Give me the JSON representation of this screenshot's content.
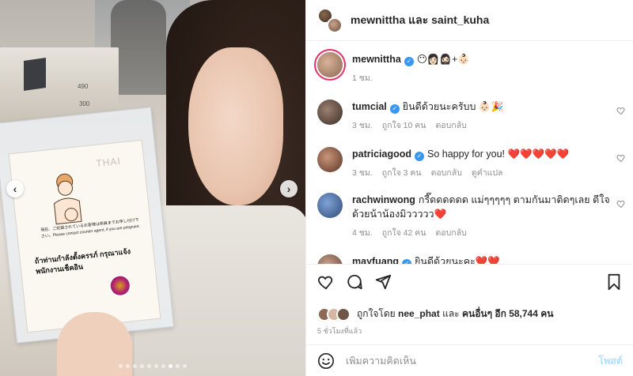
{
  "header": {
    "title": "mewnittha และ saint_kuha"
  },
  "comments": [
    {
      "user": "mewnittha",
      "text": "😶👩🏻🧔🏻‍♀️+👶🏻",
      "time": "1 ชม.",
      "likes": "",
      "reply": "",
      "translate": "",
      "avatar_color": "#b58c6e"
    },
    {
      "user": "tumcial",
      "text": "ยินดีด้วยนะครับบ 👶🏻🎉",
      "time": "3 ชม.",
      "likes": "ถูกใจ 10 คน",
      "reply": "ตอบกลับ",
      "translate": "",
      "avatar_color": "#6d5a4e"
    },
    {
      "user": "patriciagood",
      "text": "So happy for you! ❤️❤️❤️❤️❤️",
      "time": "3 ชม.",
      "likes": "ถูกใจ 3 คน",
      "reply": "ตอบกลับ",
      "translate": "ดูคำแปล",
      "avatar_color": "#8b5a45"
    },
    {
      "user": "rachwinwong",
      "text": "กรี๊ดดดดดด แม่ๆๆๆๆๆ ตามกันมาติดๆเลย ดีใจด้วยน้าน้องมิววววว❤️",
      "time": "4 ชม.",
      "likes": "ถูกใจ 42 คน",
      "reply": "ตอบกลับ",
      "translate": "",
      "avatar_color": "#4a6fa5"
    },
    {
      "user": "mayfuang",
      "text": "ยินดีด้วยนะคะ❤️❤️",
      "time": "",
      "likes": "",
      "reply": "",
      "translate": "",
      "avatar_color": "#a07a66"
    }
  ],
  "likes": {
    "prefix": "ถูกใจโดย",
    "by": "nee_phat",
    "and": "และ",
    "others": "คนอื่นๆ อีก 58,744 คน"
  },
  "time_ago": "5 ชั่วโมงที่แล้ว",
  "add_comment": {
    "placeholder": "เพิ่มความคิดเห็น",
    "post_label": "โพสต์"
  },
  "photo": {
    "card_jp": "現在、ご妊娠されているお客様は係員までお申し付け下さい。Please contact counter agent, if you are pregnant.",
    "card_th": "ถ้าท่านกำลังตั้งครรภ์ กรุณาแจ้งพนักงานเช็คอิน",
    "card_logo": "THAI",
    "counter_num_1": "490",
    "counter_num_2": "300"
  },
  "colors": {
    "accent": "#3897f0",
    "heart": "#ed4956",
    "story_ring": "#e1306c"
  },
  "icons": [
    "heart-icon",
    "comment-icon",
    "share-icon",
    "bookmark-icon",
    "emoji-icon",
    "verified-icon",
    "chevron-left-icon",
    "chevron-right-icon"
  ]
}
